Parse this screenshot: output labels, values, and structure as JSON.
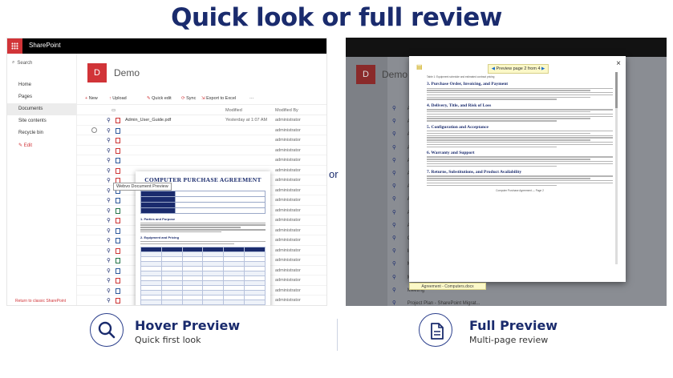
{
  "headline": "Quick look or full review",
  "or_label": "or",
  "left_panel": {
    "suite_name": "SharePoint",
    "search_label": "Search",
    "nav": [
      "Home",
      "Pages",
      "Documents",
      "Site contents",
      "Recycle bin"
    ],
    "nav_selected": "Documents",
    "edit_label": "Edit",
    "return_link": "Return to classic SharePoint",
    "site_logo_letter": "D",
    "site_title": "Demo",
    "commands": [
      {
        "icon": "+",
        "label": "New"
      },
      {
        "icon": "↑",
        "label": "Upload"
      },
      {
        "icon": "✎",
        "label": "Quick edit"
      },
      {
        "icon": "⟳",
        "label": "Sync"
      },
      {
        "icon": "⇲",
        "label": "Export to Excel"
      },
      {
        "icon": "",
        "label": "···"
      }
    ],
    "columns": {
      "modified": "Modified",
      "modified_by": "Modified By"
    },
    "file_rows": [
      {
        "name": "Admin_User_Guide.pdf",
        "date": "Yesterday at 1:07 AM",
        "by": "administrator",
        "type": "pdf"
      },
      {
        "name": "",
        "date": "",
        "by": "administrator",
        "type": "doc"
      },
      {
        "name": "",
        "date": "",
        "by": "administrator",
        "type": "pdf"
      },
      {
        "name": "",
        "date": "",
        "by": "administrator",
        "type": "pdf"
      },
      {
        "name": "",
        "date": "",
        "by": "administrator",
        "type": "doc"
      },
      {
        "name": "",
        "date": "",
        "by": "administrator",
        "type": "pdf"
      },
      {
        "name": "",
        "date": "",
        "by": "administrator",
        "type": "pdf"
      },
      {
        "name": "",
        "date": "",
        "by": "administrator",
        "type": "doc"
      },
      {
        "name": "",
        "date": "",
        "by": "administrator",
        "type": "doc"
      },
      {
        "name": "",
        "date": "",
        "by": "administrator",
        "type": "xls"
      },
      {
        "name": "",
        "date": "",
        "by": "administrator",
        "type": "pdf"
      },
      {
        "name": "",
        "date": "",
        "by": "administrator",
        "type": "doc"
      },
      {
        "name": "",
        "date": "",
        "by": "administrator",
        "type": "doc"
      },
      {
        "name": "",
        "date": "",
        "by": "administrator",
        "type": "pdf"
      },
      {
        "name": "",
        "date": "",
        "by": "administrator",
        "type": "xls"
      },
      {
        "name": "",
        "date": "",
        "by": "administrator",
        "type": "doc"
      },
      {
        "name": "",
        "date": "",
        "by": "administrator",
        "type": "pdf"
      },
      {
        "name": "",
        "date": "",
        "by": "administrator",
        "type": "doc"
      },
      {
        "name": "",
        "date": "",
        "by": "administrator",
        "type": "pdf"
      }
    ],
    "hover_tooltip": "Webvo Document Preview",
    "hover_doc": {
      "title": "COMPUTER PURCHASE AGREEMENT",
      "section1": "1. Parties and Purpose",
      "section2": "2. Equipment and Pricing"
    }
  },
  "right_panel": {
    "site_logo_letter": "D",
    "site_title": "Demo",
    "rows": [
      "Admin",
      "Agreem",
      "Agreem",
      "Agreem",
      "Agreem",
      "Agreem",
      "Agreem",
      "Agreem",
      "Agreem",
      "Agreem",
      "Contrac",
      "Invoice",
      "Mechan",
      "Meeting",
      "Meeting",
      "Project Plan - SharePoint Migrat..."
    ],
    "page_indicator": "Preview page 2 from 4",
    "close": "×",
    "doc_intro": "Table 1: Equipment schedule and estimated contract pricing",
    "sections": [
      "3. Purchase Order, Invoicing, and Payment",
      "4. Delivery, Title, and Risk of Loss",
      "5. Configuration and Acceptance",
      "6. Warranty and Support",
      "7. Returns, Substitutions, and Product Availability"
    ],
    "footer_tab": "Agreement - Computers.docx",
    "doc_footer": "Computer Purchase Agreement — Page 2"
  },
  "features": [
    {
      "icon": "search-icon",
      "title": "Hover Preview",
      "subtitle": "Quick first look"
    },
    {
      "icon": "document-icon",
      "title": "Full Preview",
      "subtitle": "Multi-page review"
    }
  ],
  "colors": {
    "brand_navy": "#1a2b6d",
    "sharepoint_red": "#d13438",
    "highlight_yellow": "#fbf8c8"
  }
}
